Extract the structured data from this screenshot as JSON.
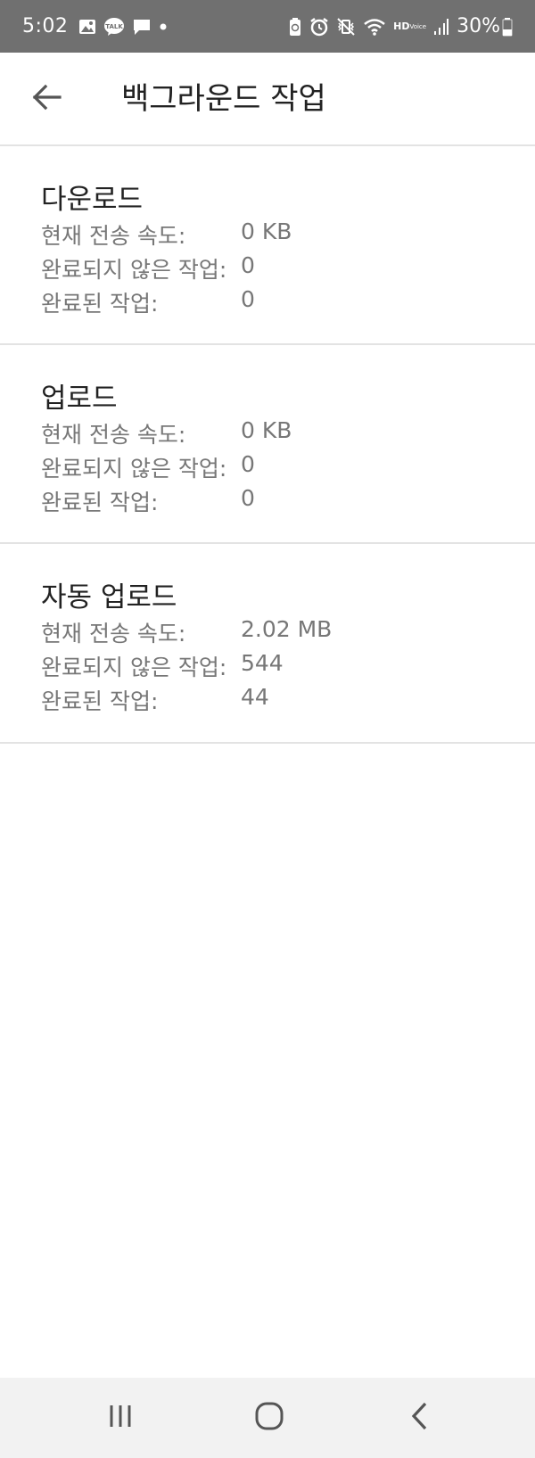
{
  "status_bar": {
    "time": "5:02",
    "hd": "HD",
    "voice": "Voice",
    "talk": "TALK",
    "battery": "30%"
  },
  "header": {
    "title": "백그라운드 작업"
  },
  "sections": [
    {
      "title": "다운로드",
      "rows": [
        {
          "label": "현재 전송 속도:",
          "value": "0 KB"
        },
        {
          "label": "완료되지 않은 작업:",
          "value": "0"
        },
        {
          "label": "완료된 작업:",
          "value": "0"
        }
      ]
    },
    {
      "title": "업로드",
      "rows": [
        {
          "label": "현재 전송 속도:",
          "value": "0 KB"
        },
        {
          "label": "완료되지 않은 작업:",
          "value": "0"
        },
        {
          "label": "완료된 작업:",
          "value": "0"
        }
      ]
    },
    {
      "title": "자동 업로드",
      "rows": [
        {
          "label": "현재 전송 속도:",
          "value": "2.02 MB"
        },
        {
          "label": "완료되지 않은 작업:",
          "value": "544"
        },
        {
          "label": "완료된 작업:",
          "value": "44"
        }
      ]
    }
  ],
  "icons": {
    "back": "arrow-left-icon",
    "nav_recents": "recents-icon",
    "nav_home": "home-icon",
    "nav_back": "back-chevron-icon"
  },
  "colors": {
    "status_bar": "#707070",
    "divider": "#e3e3e3",
    "secondary_text": "#777777",
    "primary_text": "#222222",
    "nav_bar": "#f2f2f2"
  }
}
